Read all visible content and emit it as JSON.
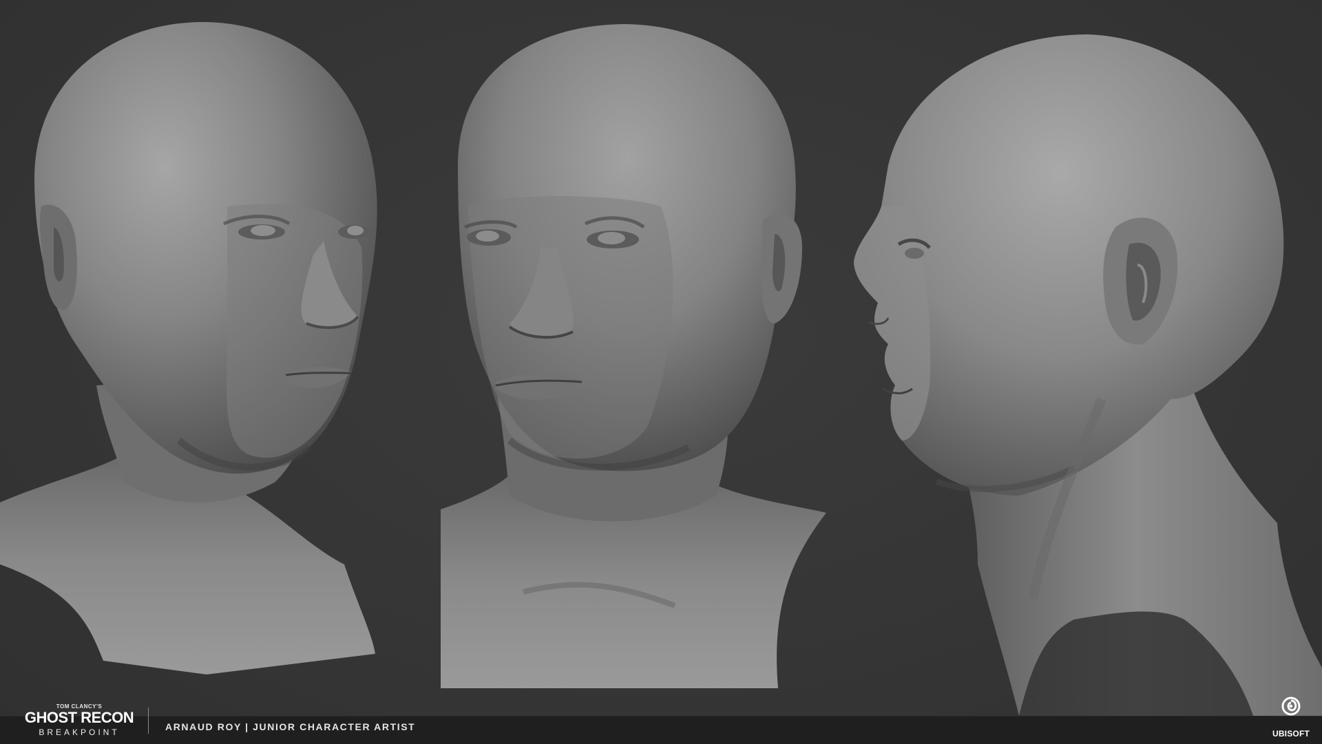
{
  "header_brand": {
    "publisher_line": "TOM CLANCY'S",
    "title_line": "GHOST RECON",
    "subtitle_line": "BREAKPOINT"
  },
  "credit": {
    "text": "ARNAUD ROY | JUNIOR CHARACTER ARTIST"
  },
  "publisher_logo": {
    "label": "UBISOFT",
    "icon": "ubisoft-swirl-icon"
  },
  "colors": {
    "background": "#363636",
    "footer": "#1f1f1f",
    "sculpt_clay": "#8c8c8c",
    "text": "#ffffff"
  },
  "scene": {
    "subject": "three-sculpt-views",
    "views": [
      "three-quarter-right",
      "three-quarter-left",
      "profile-left"
    ]
  }
}
